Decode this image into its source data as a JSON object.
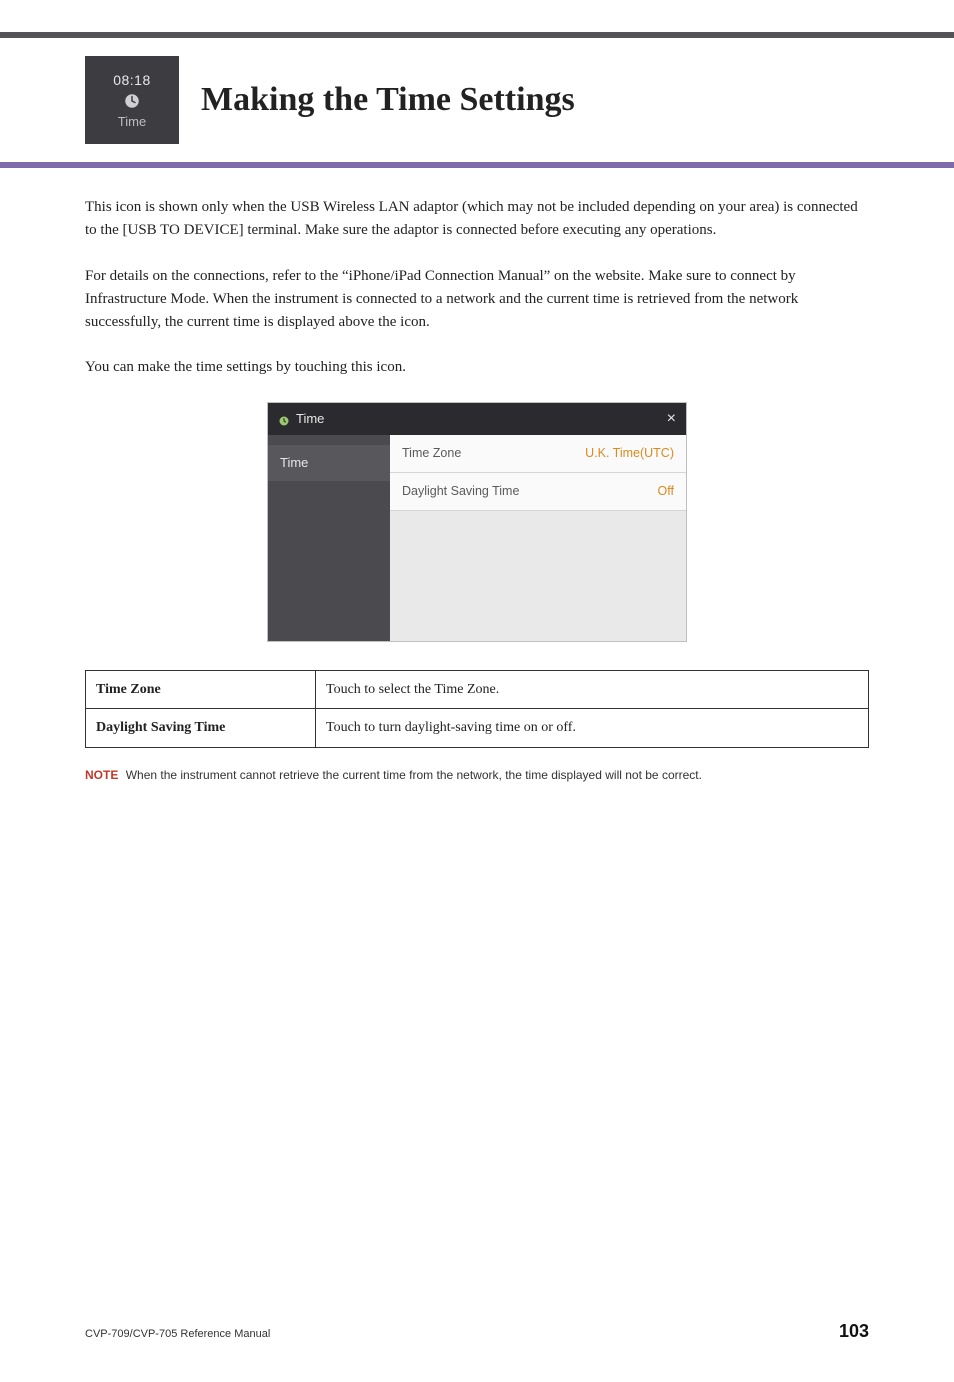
{
  "timeTile": {
    "clock": "08:18",
    "label": "Time"
  },
  "pageTitle": "Making the Time Settings",
  "paragraphs": {
    "p1": "This icon is shown only when the USB Wireless LAN adaptor (which may not be included depending on your area) is connected to the [USB TO DEVICE] terminal. Make sure the adaptor is connected before executing any operations.",
    "p2": "For details on the connections, refer to the “iPhone/iPad Connection Manual” on the website. Make sure to connect by Infrastructure Mode. When the instrument is connected to a network and the current time is retrieved from the network successfully, the current time is displayed above the icon.",
    "p3": "You can make the time settings by touching this icon."
  },
  "screenshot": {
    "headerTitle": "Time",
    "sidebarItem": "Time",
    "rows": [
      {
        "label": "Time Zone",
        "value": "U.K. Time(UTC)"
      },
      {
        "label": "Daylight Saving Time",
        "value": "Off"
      }
    ]
  },
  "defTable": [
    {
      "term": "Time Zone",
      "desc": "Touch to select the Time Zone."
    },
    {
      "term": "Daylight Saving Time",
      "desc": "Touch to turn daylight-saving time on or off."
    }
  ],
  "note": {
    "label": "NOTE",
    "text": "When the instrument cannot retrieve the current time from the network, the time displayed will not be correct."
  },
  "footer": {
    "docTitle": "CVP-709/CVP-705 Reference Manual",
    "pageNumber": "103"
  }
}
